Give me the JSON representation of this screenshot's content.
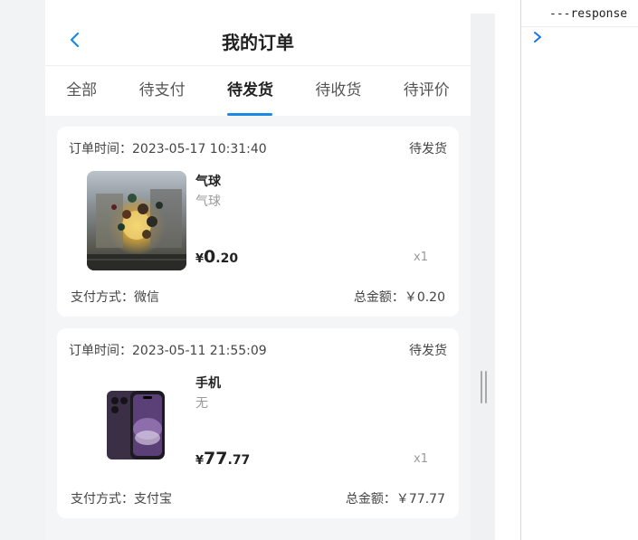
{
  "header": {
    "title": "我的订单",
    "back_icon": "chevron-left-icon"
  },
  "tabs": [
    {
      "label": "全部",
      "active": false
    },
    {
      "label": "待支付",
      "active": false
    },
    {
      "label": "待发货",
      "active": true
    },
    {
      "label": "待收货",
      "active": false
    },
    {
      "label": "待评价",
      "active": false
    }
  ],
  "orders": [
    {
      "time_label": "订单时间：2023-05-17 10:31:40",
      "status": "待发货",
      "product_name": "气球",
      "product_desc": "气球",
      "price_symbol": "¥",
      "price_int": "0",
      "price_dec": ".20",
      "quantity": "x1",
      "payment": "支付方式：微信",
      "total": "总金额：￥0.20"
    },
    {
      "time_label": "订单时间：2023-05-11 21:55:09",
      "status": "待发货",
      "product_name": "手机",
      "product_desc": "无",
      "price_symbol": "¥",
      "price_int": "77",
      "price_dec": ".77",
      "quantity": "x1",
      "payment": "支付方式：支付宝",
      "total": "总金额：￥77.77"
    }
  ],
  "console": {
    "text": "---response",
    "prompt_icon": "chevron-right-icon"
  },
  "colors": {
    "accent": "#1e88e5",
    "page_bg": "#f4f5f7"
  }
}
